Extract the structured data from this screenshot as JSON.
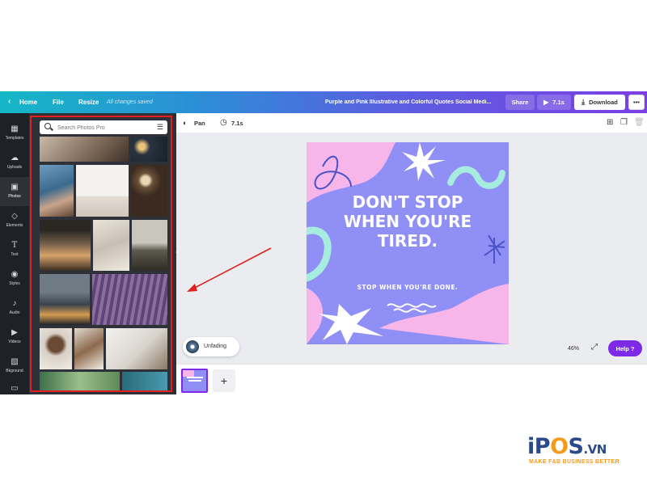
{
  "topbar": {
    "home_label": "Home",
    "file_label": "File",
    "resize_label": "Resize",
    "saved_status": "All changes saved",
    "doc_title": "Purple and Pink Illustrative and Colorful Quotes Social Medi...",
    "share_label": "Share",
    "play_label": "7.1s",
    "download_label": "Download",
    "more_label": "•••"
  },
  "rail": {
    "items": [
      {
        "label": "Templates",
        "icon": "templates-icon"
      },
      {
        "label": "Uploads",
        "icon": "upload-icon"
      },
      {
        "label": "Photos",
        "icon": "image-icon"
      },
      {
        "label": "Elements",
        "icon": "shapes-icon"
      },
      {
        "label": "Text",
        "icon": "text-icon"
      },
      {
        "label": "Styles",
        "icon": "palette-icon"
      },
      {
        "label": "Audio",
        "icon": "music-icon"
      },
      {
        "label": "Videos",
        "icon": "video-icon"
      },
      {
        "label": "Bkground",
        "icon": "background-icon"
      }
    ]
  },
  "panel": {
    "search_placeholder": "Search Photos Pro"
  },
  "editor": {
    "pan_label": "Pan",
    "timer_label": "7.1s"
  },
  "design": {
    "title_line1": "DON'T STOP",
    "title_line2": "WHEN YOU'RE",
    "title_line3": "TIRED.",
    "subtitle": "STOP WHEN YOU'RE DONE."
  },
  "bottom": {
    "audio_track": "Unfading",
    "zoom": "46%",
    "help_label": "Help  ?",
    "add_page": "+"
  },
  "watermark": {
    "brand_i": "i",
    "brand_p": "P",
    "brand_o": "O",
    "brand_s": "S",
    "brand_vn": ".VN",
    "tagline": "MAKE F&B BUSINESS BETTER"
  },
  "colors": {
    "accent": "#7d2ae8",
    "annotation": "#e02020",
    "design_bg": "#8f8ff6",
    "design_pink": "#f7b6e9",
    "design_mint": "#a6ecdf"
  }
}
